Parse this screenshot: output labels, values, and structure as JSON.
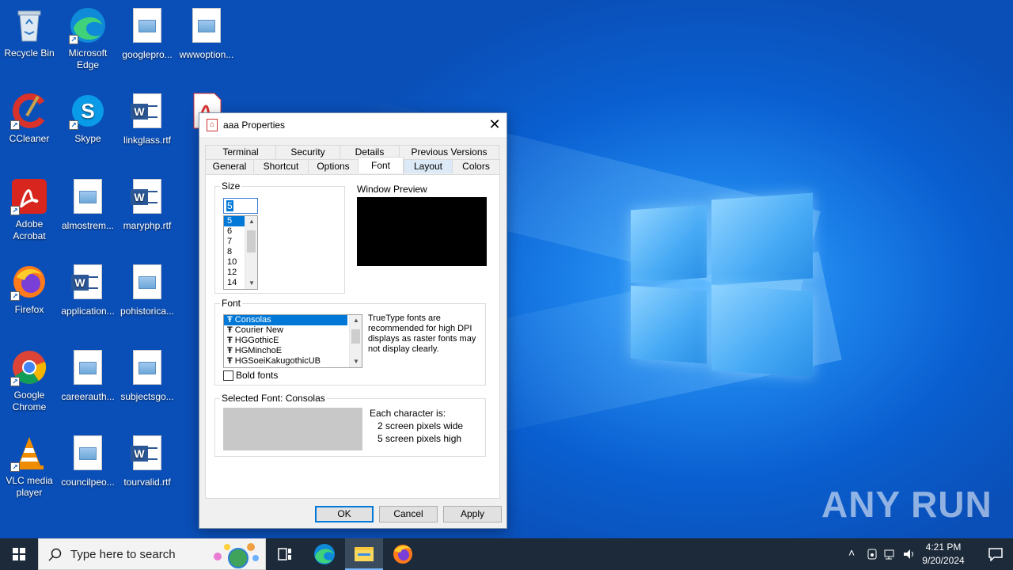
{
  "desktop": {
    "icons": [
      {
        "label": "Recycle Bin"
      },
      {
        "label": "Microsoft Edge"
      },
      {
        "label": "googlepro..."
      },
      {
        "label": "wwwoption..."
      },
      {
        "label": "CCleaner"
      },
      {
        "label": "Skype"
      },
      {
        "label": "linkglass.rtf"
      },
      {
        "label": "Adobe Acrobat"
      },
      {
        "label": "almostrem..."
      },
      {
        "label": "maryphp.rtf"
      },
      {
        "label": "Firefox"
      },
      {
        "label": "application..."
      },
      {
        "label": "pohistorica..."
      },
      {
        "label": "Google Chrome"
      },
      {
        "label": "careerauth..."
      },
      {
        "label": "subjectsgo..."
      },
      {
        "label": "VLC media player"
      },
      {
        "label": "councilpeo..."
      },
      {
        "label": "tourvalid.rtf"
      }
    ],
    "watermark": "ANY RUN"
  },
  "dialog": {
    "title": "aaa Properties",
    "close_glyph": "✕",
    "tabs_row1": [
      "Terminal",
      "Security",
      "Details",
      "Previous Versions"
    ],
    "tabs_row2": [
      "General",
      "Shortcut",
      "Options",
      "Font",
      "Layout",
      "Colors"
    ],
    "active_tab": "Font",
    "size": {
      "label": "Size",
      "value": "5",
      "options": [
        "5",
        "6",
        "7",
        "8",
        "10",
        "12",
        "14"
      ],
      "selected": "5"
    },
    "window_preview_label": "Window Preview",
    "font": {
      "label": "Font",
      "items": [
        "Consolas",
        "Courier New",
        "HGGothicE",
        "HGMinchoE",
        "HGSoeiKakugothicUB"
      ],
      "selected": "Consolas",
      "hint": "TrueType fonts are recommended for high DPI displays as raster fonts may not display clearly.",
      "bold_label": "Bold fonts",
      "bold_checked": false
    },
    "selected_font": {
      "label": "Selected Font: Consolas",
      "each_char": "Each character is:",
      "width_text": "2 screen pixels wide",
      "height_text": "5 screen pixels high"
    },
    "buttons": {
      "ok": "OK",
      "cancel": "Cancel",
      "apply": "Apply"
    }
  },
  "taskbar": {
    "search_placeholder": "Type here to search",
    "time": "4:21 PM",
    "date": "9/20/2024"
  }
}
